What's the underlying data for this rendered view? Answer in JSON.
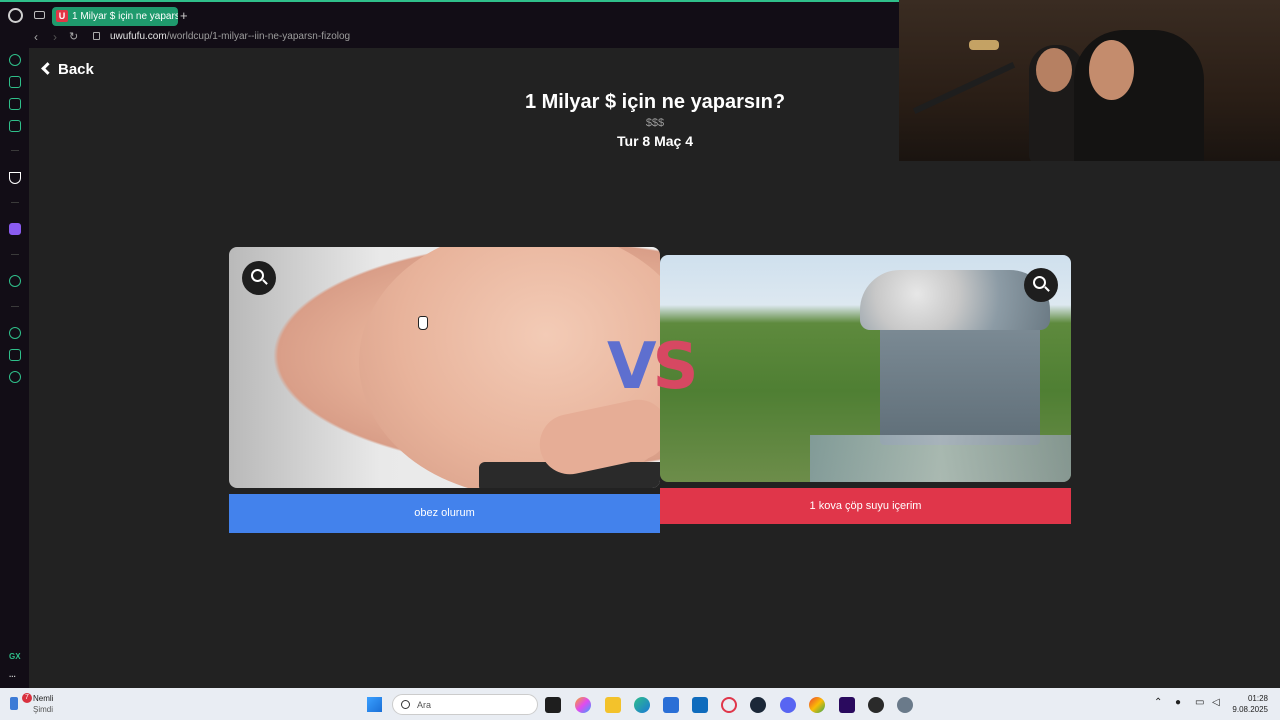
{
  "browser": {
    "tab_title": "1 Milyar $ için ne yaparsın",
    "tab_favicon_letter": "U",
    "new_tab_label": "+",
    "url_domain": "uwufufu.com",
    "url_path": "/worldcup/1-milyar--iin-ne-yaparsn-fizolog"
  },
  "sidebar": {
    "items": [
      "refresh-icon",
      "bag-icon",
      "flow-icon",
      "m-icon",
      "aria-icon",
      "twitch-icon",
      "player-icon",
      "history-icon",
      "extensions-icon",
      "settings-icon"
    ],
    "gx_label": "GX",
    "more_label": "..."
  },
  "page": {
    "back_label": "Back",
    "title": "1 Milyar $ için ne yaparsın?",
    "description": "$$$",
    "round_label": "Tur 8 Maç 4",
    "vs_left": "V",
    "vs_right": "S",
    "option_left": {
      "label": "obez olurum",
      "color": "#4382ec"
    },
    "option_right": {
      "label": "1 kova çöp suyu içerim",
      "color": "#e0364a"
    }
  },
  "taskbar": {
    "weather_badge": "7",
    "weather_label": "Nemli",
    "weather_sub": "Şimdi",
    "search_placeholder": "Ara",
    "time": "01:28",
    "date": "9.08.2025"
  }
}
